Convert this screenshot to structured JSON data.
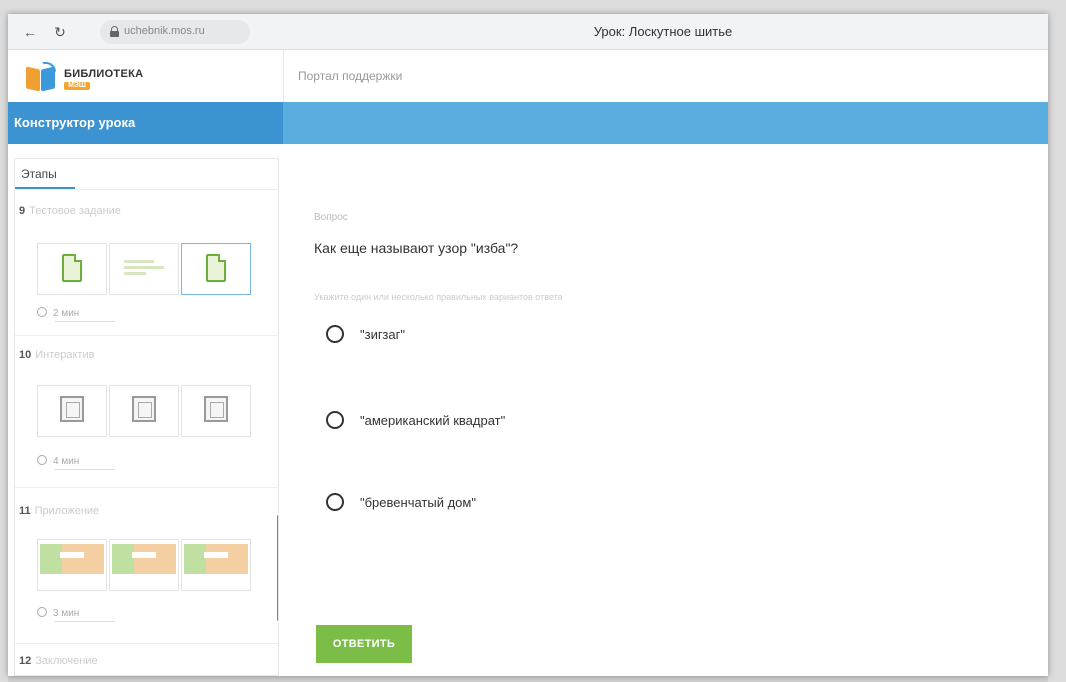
{
  "browser": {
    "back": "←",
    "reload": "↻",
    "url": "uchebnik.mos.ru",
    "tab_title": "Урок: Лоскутное шитье"
  },
  "header": {
    "logo_title": "БИБЛИОТЕКА",
    "logo_badge": "МЭШ",
    "support_link": "Портал поддержки"
  },
  "toolbar": {
    "title": "Конструктор урока"
  },
  "sidebar": {
    "tab": "Этапы",
    "stages": [
      {
        "num": "9",
        "title": "Тестовое задание",
        "timer": "2 мин"
      },
      {
        "num": "10",
        "title": "Интерактив",
        "timer": "4 мин"
      },
      {
        "num": "11",
        "title": "Приложение",
        "timer": "3 мин"
      },
      {
        "num": "12",
        "title": "Заключение"
      }
    ]
  },
  "question": {
    "label": "Вопрос",
    "text": "Как еще называют узор \"изба\"?",
    "hint": "Укажите один или несколько правильных вариантов ответа",
    "options": [
      "\"зигзаг\"",
      "\"американский квадрат\"",
      "\"бревенчатый дом\""
    ],
    "submit": "ОТВЕТИТЬ"
  },
  "colors": {
    "blue_bar": "#5aaedf",
    "blue_bar_dark": "#3b93d1",
    "button_green": "#7bbd47"
  }
}
